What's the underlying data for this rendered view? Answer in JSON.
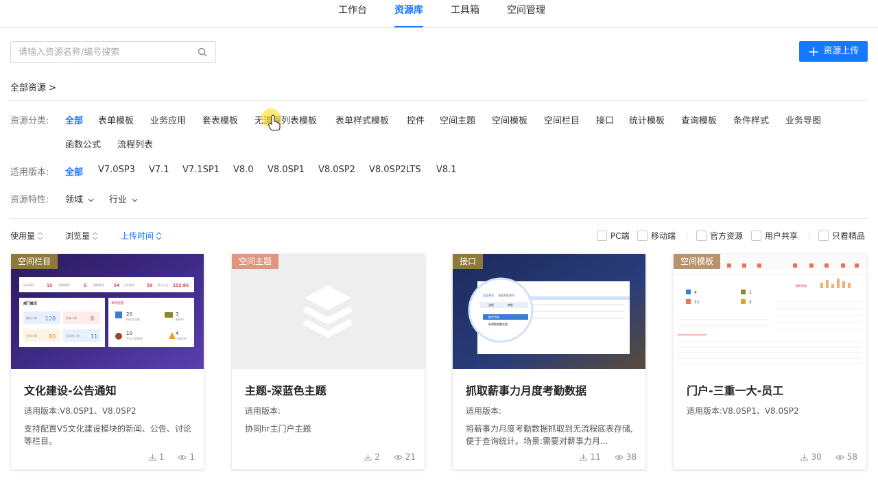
{
  "nav": {
    "tabs": [
      {
        "label": "工作台"
      },
      {
        "label": "资源库"
      },
      {
        "label": "工具箱"
      },
      {
        "label": "空间管理"
      }
    ]
  },
  "search": {
    "placeholder": "请输入资源名称/编号搜索",
    "value": ""
  },
  "upload_label": "资源上传",
  "breadcrumb": "全部资源 >",
  "filters": {
    "category_label": "资源分类:",
    "categories": [
      "全部",
      "表单模板",
      "业务应用",
      "套表模板",
      "无流程列表模板",
      "表单样式模板",
      "控件",
      "空间主题",
      "空间模板",
      "空间栏目",
      "接口",
      "统计模板",
      "查询模板",
      "条件样式",
      "业务导图",
      "函数公式",
      "流程列表"
    ],
    "version_label": "适用版本:",
    "versions": [
      "全部",
      "V7.0SP3",
      "V7.1",
      "V7.1SP1",
      "V8.0",
      "V8.0SP1",
      "V8.0SP2",
      "V8.0SP2LTS",
      "V8.1"
    ],
    "feature_label": "资源特性:",
    "features": [
      "领域",
      "行业"
    ]
  },
  "sort": {
    "usage": "使用量",
    "views": "浏览量",
    "upload_time": "上传时间"
  },
  "checks": {
    "pc": "PC端",
    "mobile": "移动端",
    "official": "官方资源",
    "shared": "用户共享",
    "premium": "只看精品"
  },
  "accent_color": "#1677ff",
  "cards": [
    {
      "badge": "空间栏目",
      "badge_color": "#8e7a3b",
      "title": "文化建设-公告通知",
      "version": "适用版本:V8.0SP1、V8.0SP2",
      "desc": "支持配置V5文化建设模块的新闻、公告、讨论等栏目。",
      "downloads": "1",
      "views": "1",
      "preview": {
        "stats": [
          {
            "label": "待办事项",
            "value": "15"
          },
          {
            "label": "超期事项",
            "value": "5"
          },
          {
            "label": "跟踪事项",
            "value": "54"
          },
          {
            "label": "已办事项",
            "value": "59"
          },
          {
            "label": "累计已办",
            "value": "152.86"
          }
        ],
        "section_left": "部门概况",
        "section_right": "事项提醒",
        "left_items": [
          {
            "label": "编制人数",
            "value": "128"
          },
          {
            "label": "缺编人数",
            "value": "8"
          },
          {
            "label": "在岗人数",
            "value": "80"
          },
          {
            "label": "试用期人数",
            "value": "11"
          }
        ],
        "right_items": [
          {
            "value": "20",
            "label": "待办会议数"
          },
          {
            "value": "3",
            "label": "新闻中"
          },
          {
            "value": "10",
            "label": "今日入职报到"
          },
          {
            "value": "4",
            "label": "上报异常"
          }
        ]
      }
    },
    {
      "badge": "空间主题",
      "badge_color": "#e0957e",
      "title": "主题-深蓝色主题",
      "version": "适用版本:",
      "desc": "协同hr主门户主题",
      "downloads": "2",
      "views": "21"
    },
    {
      "badge": "接口",
      "badge_color": "#8e7a3b",
      "title": "抓取薪事力月度考勤数据",
      "version": "适用版本:",
      "desc": "将薪事力月度考勤数据抓取到无流程底表存储,便于查询统计。场景:需要对薪事力月...",
      "downloads": "11",
      "views": "38",
      "preview": {
        "tab1": "全部事项",
        "tab2": "流程审批事项",
        "menu1": "流程",
        "menu2": "审批",
        "item1": "触发流程",
        "item2": "新建数据触发器"
      }
    },
    {
      "badge": "空间模板",
      "badge_color": "#b9936b",
      "title": "门户-三重一大-员工",
      "version": "适用版本:V8.0SP1、V8.0SP2",
      "desc": "",
      "downloads": "30",
      "views": "58",
      "preview": {
        "nums": [
          "4",
          "11",
          "1",
          "2"
        ],
        "section": "最新数据"
      }
    }
  ]
}
